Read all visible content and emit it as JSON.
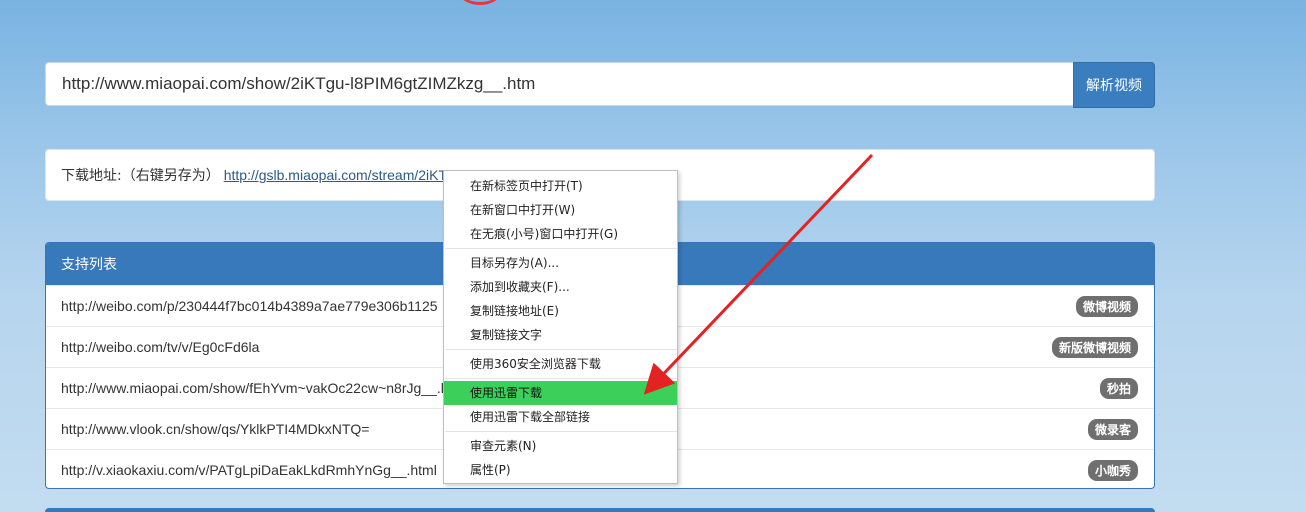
{
  "url_bar": {
    "value": "http://www.miaopai.com/show/2iKTgu-l8PIM6gtZIMZkzg__.htm",
    "button_label": "解析视频"
  },
  "download": {
    "label": "下载地址:（右键另存为）",
    "link_text": "http://gslb.miaopai.com/stream/2iKTgu-l8PIM6gtZIMZkzg__.mp4"
  },
  "support": {
    "title": "支持列表",
    "rows": [
      {
        "url": "http://weibo.com/p/230444f7bc014b4389a7ae779e306b1125",
        "badge": "微博视频"
      },
      {
        "url": "http://weibo.com/tv/v/Eg0cFd6la",
        "badge": "新版微博视频"
      },
      {
        "url": "http://www.miaopai.com/show/fEhYvm~vakOc22cw~n8rJg__.htm",
        "badge": "秒拍"
      },
      {
        "url": "http://www.vlook.cn/show/qs/YklkPTI4MDkxNTQ=",
        "badge": "微录客"
      },
      {
        "url": "http://v.xiaokaxiu.com/v/PATgLpiDaEakLkdRmhYnGg__.html",
        "badge": "小咖秀"
      }
    ]
  },
  "context_menu": {
    "groups": [
      [
        "在新标签页中打开(T)",
        "在新窗口中打开(W)",
        "在无痕(小号)窗口中打开(G)"
      ],
      [
        "目标另存为(A)...",
        "添加到收藏夹(F)...",
        "复制链接地址(E)",
        "复制链接文字"
      ],
      [
        "使用360安全浏览器下载"
      ],
      [
        "使用迅雷下载",
        "使用迅雷下载全部链接"
      ],
      [
        "审查元素(N)",
        "属性(P)"
      ]
    ],
    "highlighted": "使用迅雷下载"
  },
  "colors": {
    "accent": "#3779ba",
    "highlight": "#3ccf5a",
    "arrow": "#e52222"
  }
}
